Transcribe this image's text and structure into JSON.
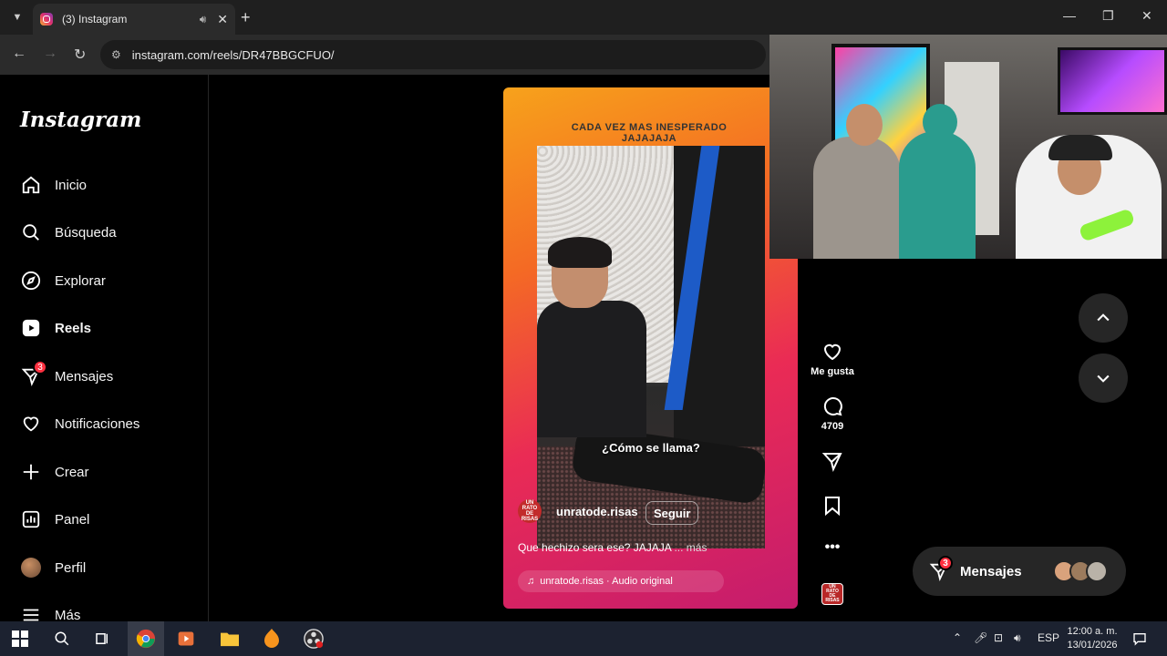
{
  "browser": {
    "tab_title": "(3) Instagram",
    "url": "instagram.com/reels/DR47BBGCFUO/"
  },
  "sidebar": {
    "logo": "Instagram",
    "items": [
      {
        "label": "Inicio",
        "icon": "home-icon"
      },
      {
        "label": "Búsqueda",
        "icon": "search-icon"
      },
      {
        "label": "Explorar",
        "icon": "compass-icon"
      },
      {
        "label": "Reels",
        "icon": "reels-icon"
      },
      {
        "label": "Mensajes",
        "icon": "messenger-icon",
        "badge": "3"
      },
      {
        "label": "Notificaciones",
        "icon": "heart-icon"
      },
      {
        "label": "Crear",
        "icon": "plus-icon"
      },
      {
        "label": "Panel",
        "icon": "chart-icon"
      },
      {
        "label": "Perfil",
        "icon": "avatar"
      },
      {
        "label": "Más",
        "icon": "menu-icon"
      }
    ]
  },
  "reel": {
    "overlay_text_line1": "CADA VEZ MAS INESPERADO",
    "overlay_text_line2": "JAJAJAJA",
    "subtitle": "¿Cómo se llama?",
    "username": "unratode.risas",
    "avatar_text": "UN RATO DE RISAS",
    "follow_label": "Seguir",
    "description": "Que hechizo sera ese? JAJAJA",
    "more_label": "... más",
    "audio": "unratode.risas · Audio original"
  },
  "actions": {
    "like_label": "Me gusta",
    "comments_count": "4709"
  },
  "messages_pill": {
    "label": "Mensajes",
    "badge": "3"
  },
  "taskbar": {
    "language": "ESP",
    "time": "12:00 a. m.",
    "date": "13/01/2026"
  },
  "colors": {
    "instagram_badge": "#ff3040",
    "reel_gradient_start": "#f7a21b",
    "reel_gradient_end": "#c51c6d"
  }
}
